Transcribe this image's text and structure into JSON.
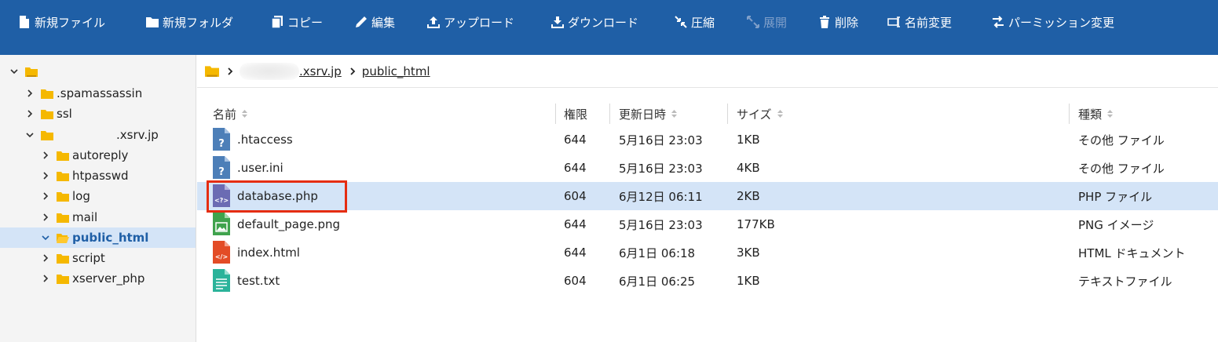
{
  "toolbar": {
    "new_file": "新規ファイル",
    "new_folder": "新規フォルダ",
    "copy": "コピー",
    "edit": "編集",
    "upload": "アップロード",
    "download": "ダウンロード",
    "compress": "圧縮",
    "extract": "展開",
    "delete": "削除",
    "rename": "名前変更",
    "permission": "パーミッション変更"
  },
  "sidebar": {
    "items": [
      {
        "label": ""
      },
      {
        "label": ".spamassassin"
      },
      {
        "label": "ssl"
      },
      {
        "label": ".xsrv.jp"
      },
      {
        "label": "autoreply"
      },
      {
        "label": "htpasswd"
      },
      {
        "label": "log"
      },
      {
        "label": "mail"
      },
      {
        "label": "public_html"
      },
      {
        "label": "script"
      },
      {
        "label": "xserver_php"
      }
    ]
  },
  "breadcrumb": {
    "domain": ".xsrv.jp",
    "folder": "public_html"
  },
  "table": {
    "headers": {
      "name": "名前",
      "perm": "権限",
      "modified": "更新日時",
      "size": "サイズ",
      "type": "種類"
    },
    "rows": [
      {
        "name": ".htaccess",
        "perm": "644",
        "modified": "5月16日 23:03",
        "size": "1KB",
        "type": "その他 ファイル",
        "icon": "unknown-file-icon"
      },
      {
        "name": ".user.ini",
        "perm": "644",
        "modified": "5月16日 23:03",
        "size": "4KB",
        "type": "その他 ファイル",
        "icon": "unknown-file-icon"
      },
      {
        "name": "database.php",
        "perm": "604",
        "modified": "6月12日 06:11",
        "size": "2KB",
        "type": "PHP ファイル",
        "icon": "php-file-icon"
      },
      {
        "name": "default_page.png",
        "perm": "644",
        "modified": "5月16日 23:03",
        "size": "177KB",
        "type": "PNG イメージ",
        "icon": "image-file-icon"
      },
      {
        "name": "index.html",
        "perm": "644",
        "modified": "6月1日 06:18",
        "size": "3KB",
        "type": "HTML ドキュメント",
        "icon": "html-file-icon"
      },
      {
        "name": "test.txt",
        "perm": "604",
        "modified": "6月1日 06:25",
        "size": "1KB",
        "type": "テキストファイル",
        "icon": "text-file-icon"
      }
    ]
  },
  "colors": {
    "toolbar_bg": "#1f5fa6",
    "selection": "#d4e4f7",
    "folder": "#f5b800",
    "highlight": "#e52d12"
  }
}
